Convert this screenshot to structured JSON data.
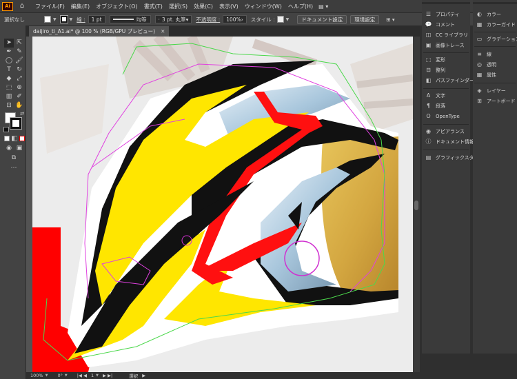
{
  "app": {
    "logo": "Ai",
    "menu": [
      "ファイル(F)",
      "編集(E)",
      "オブジェクト(O)",
      "書式(T)",
      "選択(S)",
      "効果(C)",
      "表示(V)",
      "ウィンドウ(W)",
      "ヘルプ(H)"
    ],
    "window_controls": [
      "?",
      "—",
      "□",
      "✕"
    ]
  },
  "control_bar": {
    "selection": "選択なし",
    "stroke_label": "線 :",
    "stroke_weight": "1 pt",
    "stroke_profile": "均等",
    "brush": "3 pt. 丸筆",
    "opacity_label": "不透明度 :",
    "opacity_value": "100%",
    "style_label": "スタイル :",
    "doc_settings_button": "ドキュメント設定",
    "prefs_button": "環境設定"
  },
  "document_tab": {
    "title": "daijiro_ti_A1.ai* @ 100 % (RGB/GPU プレビュー)",
    "close": "✕"
  },
  "status_bar": {
    "zoom": "100%",
    "rotation": "0°",
    "artboard": "1",
    "tool": "選択"
  },
  "panels": {
    "column1": [
      {
        "icon": "properties-icon",
        "glyph": "☰",
        "label": "プロパティ"
      },
      {
        "icon": "comments-icon",
        "glyph": "💬",
        "label": "コメント"
      },
      {
        "icon": "cc-libraries-icon",
        "glyph": "◫",
        "label": "CC ライブラリ"
      },
      {
        "icon": "image-trace-icon",
        "glyph": "▣",
        "label": "画像トレース"
      },
      {
        "icon": "transform-icon",
        "glyph": "⬚",
        "label": "変形"
      },
      {
        "icon": "align-icon",
        "glyph": "⊟",
        "label": "整列"
      },
      {
        "icon": "pathfinder-icon",
        "glyph": "◧",
        "label": "パスファインダー"
      },
      {
        "icon": "character-icon",
        "glyph": "A",
        "label": "文字"
      },
      {
        "icon": "paragraph-icon",
        "glyph": "¶",
        "label": "段落"
      },
      {
        "icon": "opentype-icon",
        "glyph": "O",
        "label": "OpenType"
      },
      {
        "icon": "appearance-icon",
        "glyph": "◉",
        "label": "アピアランス"
      },
      {
        "icon": "document-info-icon",
        "glyph": "ⓘ",
        "label": "ドキュメント情報"
      },
      {
        "icon": "graphic-styles-icon",
        "glyph": "▤",
        "label": "グラフィックスタイル"
      }
    ],
    "column2": [
      {
        "icon": "color-icon",
        "glyph": "◐",
        "label": "カラー"
      },
      {
        "icon": "color-guide-icon",
        "glyph": "▦",
        "label": "カラーガイド"
      },
      {
        "icon": "gradient-icon",
        "glyph": "▭",
        "label": "グラデーション"
      },
      {
        "icon": "stroke-icon",
        "glyph": "≡",
        "label": "線"
      },
      {
        "icon": "transparency-icon",
        "glyph": "◎",
        "label": "透明"
      },
      {
        "icon": "attributes-icon",
        "glyph": "▦",
        "label": "属性"
      },
      {
        "icon": "layers-icon",
        "glyph": "◈",
        "label": "レイヤー"
      },
      {
        "icon": "artboards-icon",
        "glyph": "⊞",
        "label": "アートボード"
      }
    ]
  },
  "colors": {
    "yellow": "#ffe600",
    "red": "#ff0000",
    "gold": "#d8a94a",
    "magenta_path": "#e040e0",
    "green_path": "#4cd84c"
  }
}
